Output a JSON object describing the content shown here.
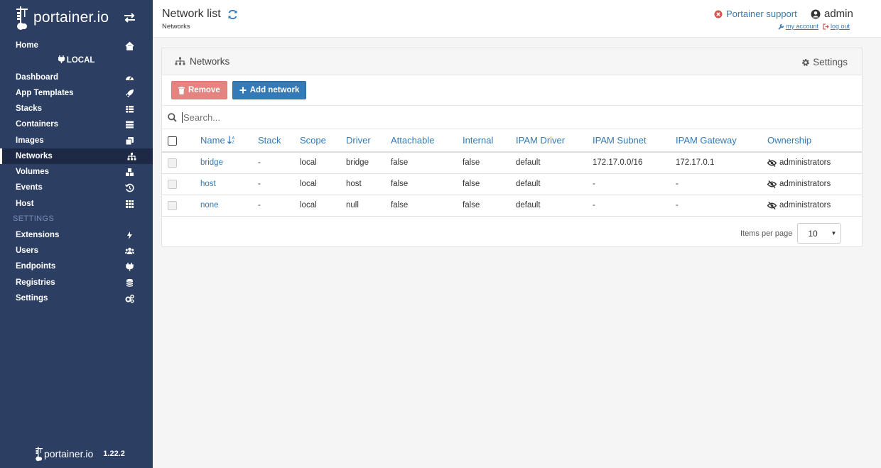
{
  "sidebar": {
    "brand": "portainer.io",
    "home": "Home",
    "endpoint": "LOCAL",
    "items": [
      {
        "label": "Dashboard",
        "icon": "tachometer-icon"
      },
      {
        "label": "App Templates",
        "icon": "rocket-icon"
      },
      {
        "label": "Stacks",
        "icon": "th-list-icon"
      },
      {
        "label": "Containers",
        "icon": "server-icon"
      },
      {
        "label": "Images",
        "icon": "clone-icon"
      },
      {
        "label": "Networks",
        "icon": "sitemap-icon"
      },
      {
        "label": "Volumes",
        "icon": "cubes-icon"
      },
      {
        "label": "Events",
        "icon": "history-icon"
      },
      {
        "label": "Host",
        "icon": "th-icon"
      }
    ],
    "settings_title": "SETTINGS",
    "settings_items": [
      {
        "label": "Extensions",
        "icon": "bolt-icon"
      },
      {
        "label": "Users",
        "icon": "users-icon"
      },
      {
        "label": "Endpoints",
        "icon": "plug-icon"
      },
      {
        "label": "Registries",
        "icon": "database-icon"
      },
      {
        "label": "Settings",
        "icon": "cogs-icon"
      }
    ],
    "footer_brand": "portainer.io",
    "version": "1.22.2"
  },
  "header": {
    "title": "Network list",
    "breadcrumb": "Networks",
    "support": "Portainer support",
    "user": "admin",
    "my_account": "my account",
    "log_out": "log out"
  },
  "panel": {
    "title": "Networks",
    "settings": "Settings",
    "remove_label": "Remove",
    "add_label": "Add network",
    "search_placeholder": "Search...",
    "columns": [
      "Name",
      "Stack",
      "Scope",
      "Driver",
      "Attachable",
      "Internal",
      "IPAM Driver",
      "IPAM Subnet",
      "IPAM Gateway",
      "Ownership"
    ],
    "rows": [
      {
        "name": "bridge",
        "stack": "-",
        "scope": "local",
        "driver": "bridge",
        "attachable": "false",
        "internal": "false",
        "ipam_driver": "default",
        "ipam_subnet": "172.17.0.0/16",
        "ipam_gateway": "172.17.0.1",
        "ownership": "administrators"
      },
      {
        "name": "host",
        "stack": "-",
        "scope": "local",
        "driver": "host",
        "attachable": "false",
        "internal": "false",
        "ipam_driver": "default",
        "ipam_subnet": "-",
        "ipam_gateway": "-",
        "ownership": "administrators"
      },
      {
        "name": "none",
        "stack": "-",
        "scope": "local",
        "driver": "null",
        "attachable": "false",
        "internal": "false",
        "ipam_driver": "default",
        "ipam_subnet": "-",
        "ipam_gateway": "-",
        "ownership": "administrators"
      }
    ],
    "items_per_page_label": "Items per page",
    "items_per_page": "10"
  },
  "colors": {
    "sidebar_bg": "#2d3e63",
    "link": "#337ab7",
    "remove_btn": "#e4837f",
    "add_btn": "#337ab7"
  }
}
